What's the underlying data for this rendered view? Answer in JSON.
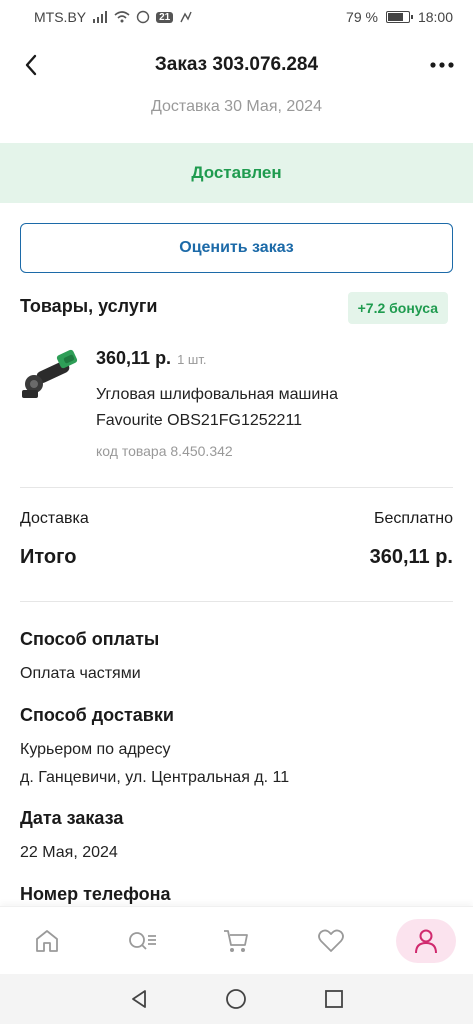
{
  "status_bar": {
    "carrier": "MTS.BY",
    "notif_count": "21",
    "battery": "79 %",
    "battery_level": 0.79,
    "time": "18:00"
  },
  "header": {
    "title": "Заказ 303.076.284",
    "back_icon": "chevron-left-icon",
    "more_icon": "more-dots-icon"
  },
  "delivery_date": "Доставка 30 Мая, 2024",
  "status": "Доставлен",
  "rate_button": "Оценить заказ",
  "goods": {
    "title": "Товары, услуги",
    "bonus": "+7.2 бонуса",
    "items": [
      {
        "price": "360,11 р.",
        "qty": "1 шт.",
        "name_line1": "Угловая шлифовальная машина",
        "name_line2": "Favourite OBS21FG1252211",
        "sku": "код товара 8.450.342"
      }
    ]
  },
  "summary": {
    "delivery_label": "Доставка",
    "delivery_value": "Бесплатно",
    "total_label": "Итого",
    "total_value": "360,11 р."
  },
  "info": {
    "payment_label": "Способ оплаты",
    "payment_value": "Оплата частями",
    "shipping_label": "Способ доставки",
    "shipping_line1": "Курьером по адресу",
    "shipping_line2": "д. Ганцевичи, ул. Центральная д. 11",
    "order_date_label": "Дата заказа",
    "order_date_value": "22 Мая, 2024",
    "phone_label": "Номер телефона"
  },
  "bottom_nav": {
    "items": [
      "home-icon",
      "catalog-search-icon",
      "cart-icon",
      "heart-icon",
      "profile-icon"
    ],
    "active": "profile-icon"
  },
  "colors": {
    "accent_green": "#1f9b4f",
    "accent_blue": "#1c6aa8",
    "accent_pink": "#d02a6e",
    "banner_bg": "#e4f4ea"
  }
}
